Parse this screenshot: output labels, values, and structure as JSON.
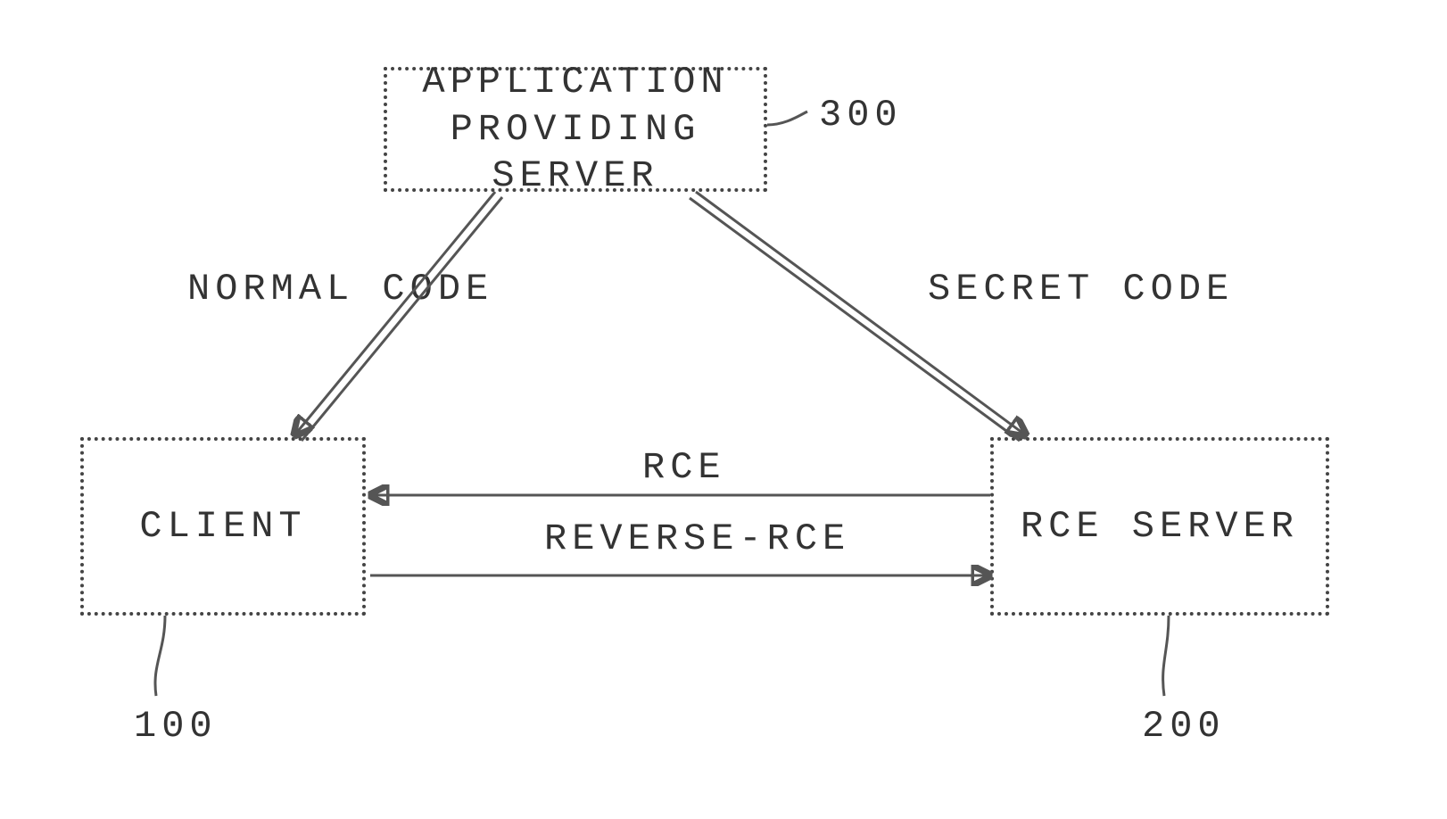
{
  "nodes": {
    "app_server": {
      "line1": "APPLICATION",
      "line2": "PROVIDING SERVER",
      "ref": "300"
    },
    "client": {
      "label": "CLIENT",
      "ref": "100"
    },
    "rce_server": {
      "label": "RCE SERVER",
      "ref": "200"
    }
  },
  "edges": {
    "normal_code": "NORMAL CODE",
    "secret_code": "SECRET CODE",
    "rce": "RCE",
    "reverse_rce": "REVERSE-RCE"
  }
}
